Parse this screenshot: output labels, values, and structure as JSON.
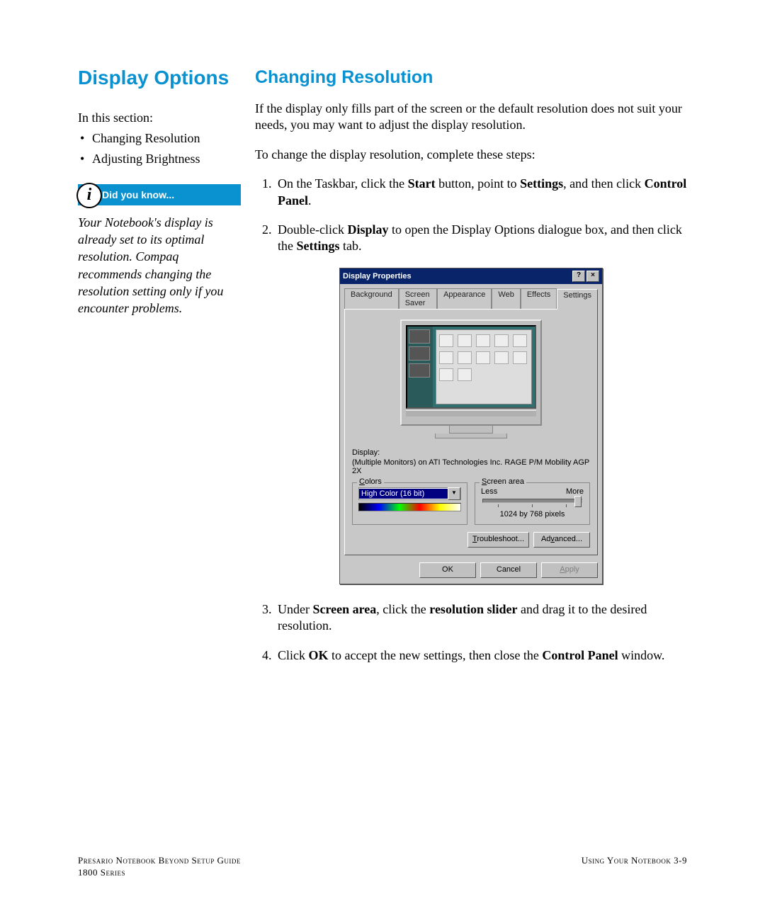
{
  "left": {
    "title": "Display Options",
    "intro": "In this section:",
    "bullets": [
      "Changing Resolution",
      "Adjusting Brightness"
    ],
    "dyk_label": "Did you know...",
    "tip": "Your Notebook's display is already set to its optimal resolution. Compaq recommends changing the resolution setting only if you encounter problems."
  },
  "right": {
    "heading": "Changing Resolution",
    "p1": "If the display only fills part of the screen or the default resolution does not suit your needs, you may want to adjust the display resolution.",
    "p2": "To change the display resolution, complete these steps:",
    "step1_a": "On the Taskbar, click the ",
    "step1_b": "Start",
    "step1_c": " button, point to ",
    "step1_d": "Settings",
    "step1_e": ", and then click ",
    "step1_f": "Control Panel",
    "step1_g": ".",
    "step2_a": "Double-click ",
    "step2_b": "Display",
    "step2_c": " to open the Display Options dialogue box, and then click the ",
    "step2_d": "Settings",
    "step2_e": " tab.",
    "step3_a": "Under ",
    "step3_b": "Screen area",
    "step3_c": ", click the ",
    "step3_d": "resolution slider",
    "step3_e": " and drag it to the desired resolution.",
    "step4_a": "Click ",
    "step4_b": "OK",
    "step4_c": " to accept the new settings, then close the ",
    "step4_d": "Control Panel",
    "step4_e": " window."
  },
  "dialog": {
    "title": "Display Properties",
    "help": "?",
    "close": "×",
    "tabs": [
      "Background",
      "Screen Saver",
      "Appearance",
      "Web",
      "Effects",
      "Settings"
    ],
    "display_label": "Display:",
    "display_desc": "(Multiple Monitors) on ATI Technologies Inc. RAGE P/M Mobility AGP 2X",
    "colors_legend": "Colors",
    "colors_value": "High Color (16 bit)",
    "screenarea_legend": "Screen area",
    "less": "Less",
    "more": "More",
    "resolution": "1024 by 768 pixels",
    "troubleshoot": "Troubleshoot...",
    "advanced": "Advanced...",
    "ok": "OK",
    "cancel": "Cancel",
    "apply": "Apply"
  },
  "footer": {
    "left1": "Presario Notebook Beyond Setup Guide",
    "left2": "1800 Series",
    "right": "Using Your Notebook   3-9"
  }
}
